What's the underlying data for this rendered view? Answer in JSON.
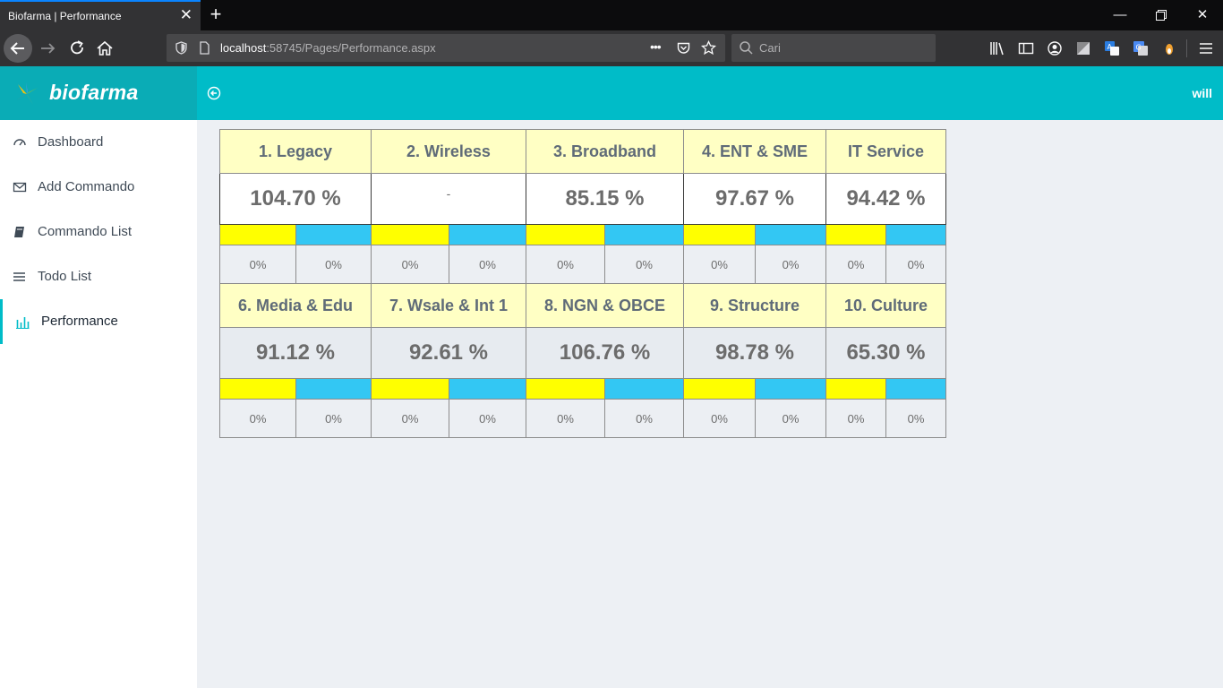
{
  "browser": {
    "tab_title": "Biofarma | Performance",
    "url_host": "localhost",
    "url_path": ":58745/Pages/Performance.aspx",
    "search_placeholder": "Cari",
    "url_more": "•••"
  },
  "app": {
    "brand": "biofarma",
    "user": "will"
  },
  "sidebar": {
    "items": [
      {
        "label": "Dashboard",
        "icon": "dashboard-gauge-icon"
      },
      {
        "label": "Add Commando",
        "icon": "envelope-icon"
      },
      {
        "label": "Commando List",
        "icon": "book-icon"
      },
      {
        "label": "Todo List",
        "icon": "list-icon"
      },
      {
        "label": "Performance",
        "icon": "bar-chart-icon",
        "active": true
      }
    ]
  },
  "performance": {
    "colors": {
      "title_bg": "#ffffc4",
      "yellow": "#ffff00",
      "blue": "#33c7f3"
    },
    "rows": [
      {
        "titles": [
          "1. Legacy",
          "2. Wireless",
          "3. Broadband",
          "4. ENT & SME",
          "IT Service"
        ],
        "values": [
          "104.70 %",
          "-",
          "85.15 %",
          "97.67 %",
          "94.42 %"
        ],
        "pcts": [
          "0%",
          "0%",
          "0%",
          "0%",
          "0%",
          "0%",
          "0%",
          "0%",
          "0%",
          "0%"
        ]
      },
      {
        "titles": [
          "6. Media & Edu",
          "7. Wsale & Int 1",
          "8. NGN & OBCE",
          "9. Structure",
          "10. Culture"
        ],
        "values": [
          "91.12 %",
          "92.61 %",
          "106.76 %",
          "98.78 %",
          "65.30 %"
        ],
        "pcts": [
          "0%",
          "0%",
          "0%",
          "0%",
          "0%",
          "0%",
          "0%",
          "0%",
          "0%",
          "0%"
        ]
      }
    ]
  }
}
